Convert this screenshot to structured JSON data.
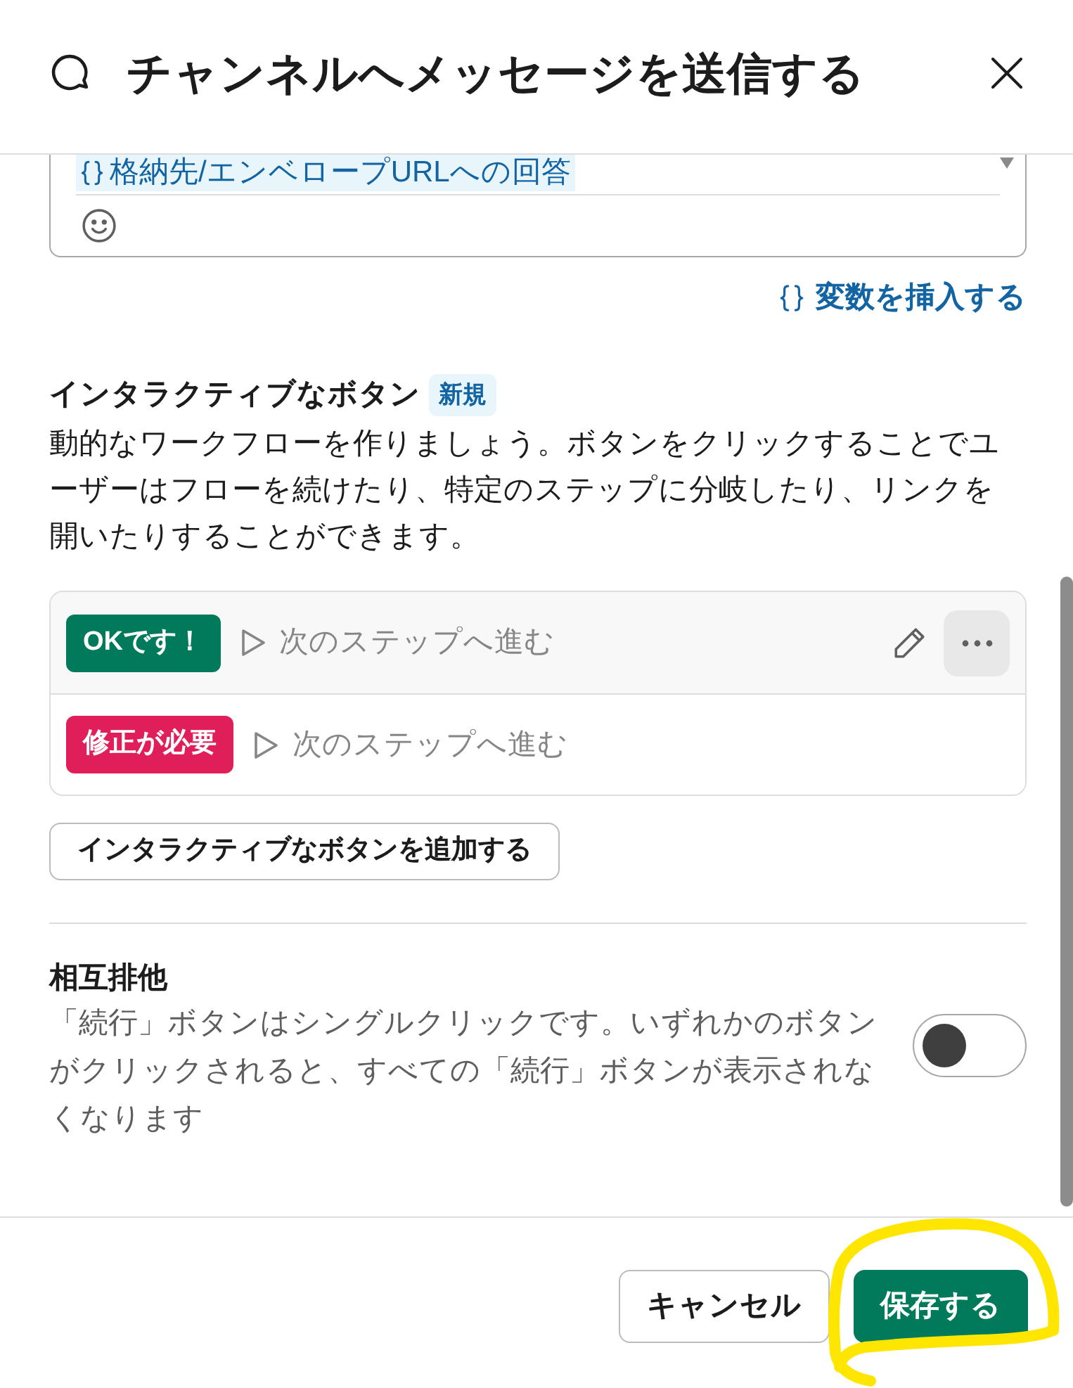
{
  "dialog": {
    "title": "チャンネルへメッセージを送信する"
  },
  "editor": {
    "variable_token": "格納先/エンベロープURLへの回答",
    "insert_variable_link": "変数を挿入する"
  },
  "interactive_buttons": {
    "title": "インタラクティブなボタン",
    "badge": "新規",
    "description": "動的なワークフローを作りましょう。ボタンをクリックすることでユーザーはフローを続けたり、特定のステップに分岐したり、リンクを開いたりすることができます。",
    "buttons": [
      {
        "label": "OKです！",
        "color": "#007a5a",
        "action": "次のステップへ進む",
        "hovered": true
      },
      {
        "label": "修正が必要",
        "color": "#e01e5a",
        "action": "次のステップへ進む",
        "hovered": false
      }
    ],
    "add_button": "インタラクティブなボタンを追加する"
  },
  "mutual_exclusion": {
    "title": "相互排他",
    "description": "「続行」ボタンはシングルクリックです。いずれかのボタンがクリックされると、すべての「続行」ボタンが表示されなくなります",
    "on": false
  },
  "footer": {
    "buttons": [
      {
        "label": "キャンセル",
        "kind": "secondary"
      },
      {
        "label": "保存する",
        "kind": "primary"
      }
    ]
  }
}
